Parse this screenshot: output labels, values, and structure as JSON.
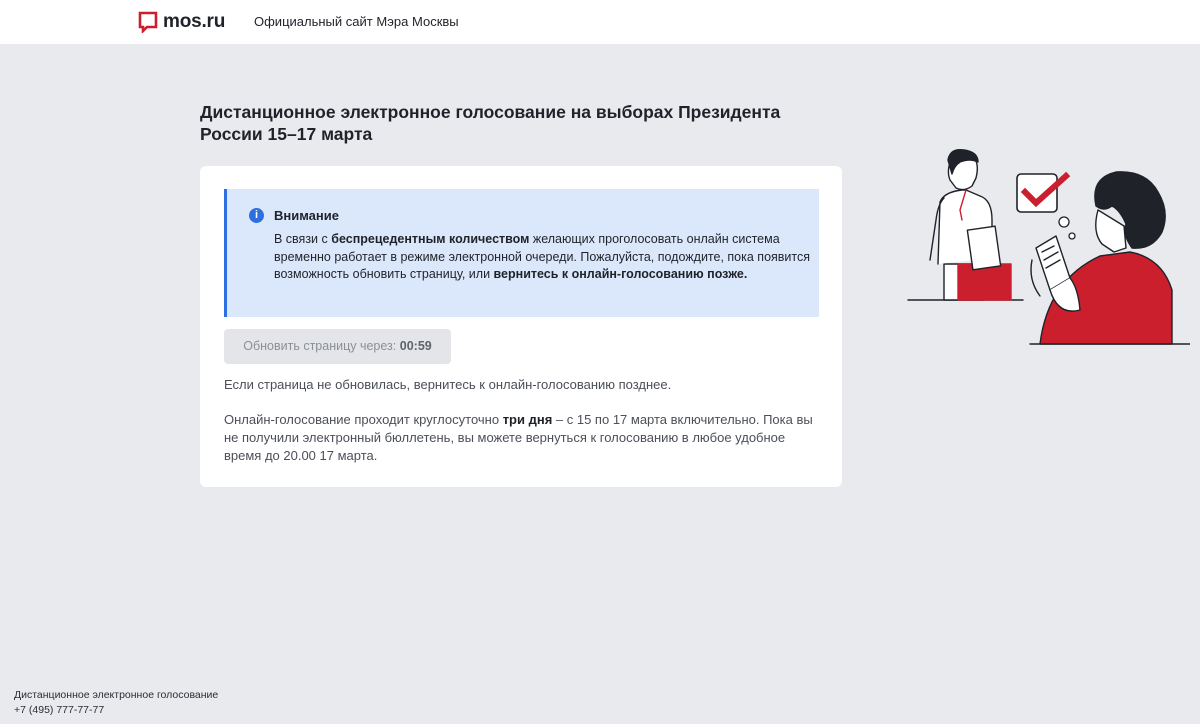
{
  "header": {
    "logo_text": "mos.ru",
    "tagline": "Официальный сайт Мэра Москвы"
  },
  "page": {
    "title": "Дистанционное электронное голосование на выборах Президента России 15–17 марта"
  },
  "notice": {
    "icon": "info-icon",
    "icon_glyph": "i",
    "title": "Внимание",
    "text_1": "В связи с ",
    "text_bold_1": "беспрецедентным количеством",
    "text_2": " желающих проголосовать онлайн система временно работает в режиме электронной очереди. Пожалуйста, подождите, пока появится возможность обновить страницу, или ",
    "text_bold_2": "вернитесь к онлайн-голосованию позже."
  },
  "refresh": {
    "label": "Обновить страницу через:",
    "timer": "00:59"
  },
  "info": {
    "paragraph_1": "Если страница не обновилась, вернитесь к онлайн-голосованию позднее.",
    "paragraph_2_a": "Онлайн-голосование проходит круглосуточно ",
    "paragraph_2_bold": "три дня",
    "paragraph_2_b": " – с 15 по 17 марта включительно. Пока вы не получили электронный бюллетень, вы можете вернуться к голосованию в любое удобное время до 20.00 17 марта."
  },
  "footer": {
    "line_1": "Дистанционное электронное голосование",
    "phone": "+7 (495) 777-77-77"
  },
  "colors": {
    "accent_red": "#cc1f2e",
    "info_blue": "#2d6fe0",
    "notice_bg": "#dbe8fb",
    "page_bg": "#e9eaee"
  }
}
